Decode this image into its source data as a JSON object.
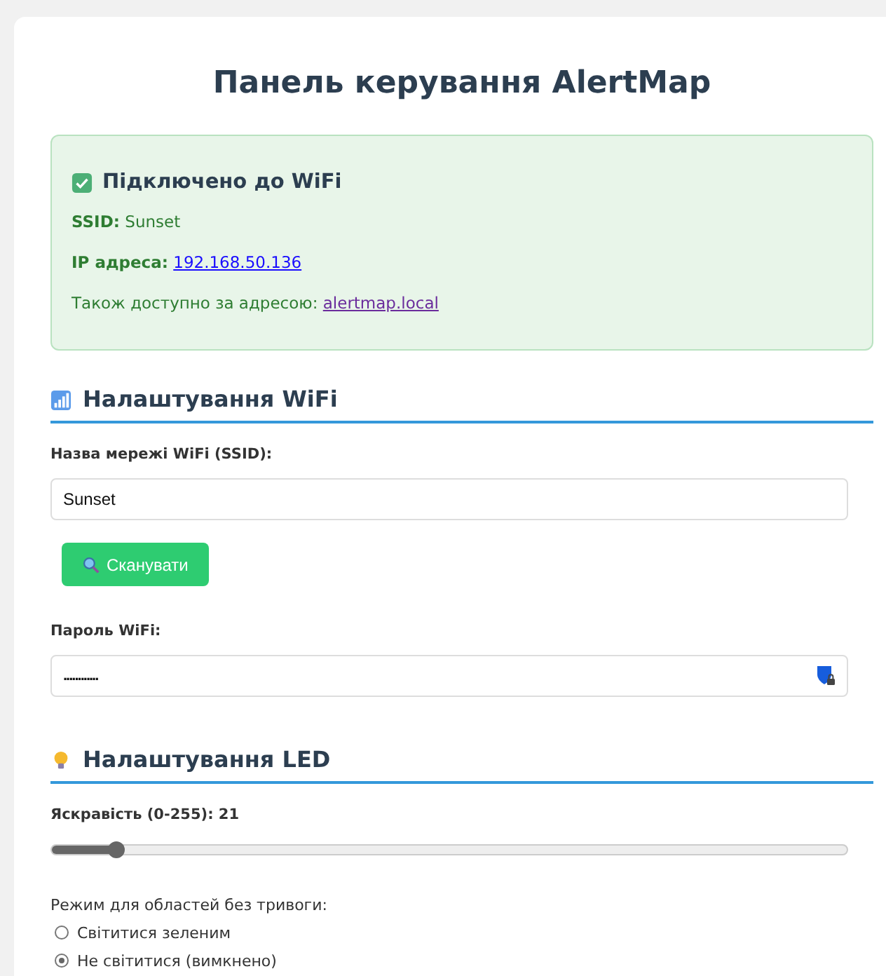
{
  "title": "Панель керування AlertMap",
  "status": {
    "connected": true,
    "heading": "Підключено до WiFi",
    "ssid_label": "SSID:",
    "ssid": "Sunset",
    "ip_label": "IP адреса:",
    "ip": "192.168.50.136",
    "alt_text": "Також доступно за адресою:",
    "alt_link": "alertmap.local"
  },
  "wifi": {
    "heading": "Налаштування WiFi",
    "ssid_label": "Назва мережі WiFi (SSID):",
    "ssid_value": "Sunset",
    "scan_button": "Сканувати",
    "password_label": "Пароль WiFi:",
    "password_value": "............"
  },
  "led": {
    "heading": "Налаштування LED",
    "brightness_label": "Яскравість (0-255): 21",
    "brightness": {
      "level": 0.082
    },
    "mode_label": "Режим для областей без тривоги:",
    "modes": [
      {
        "label": "Світитися зеленим",
        "selected": false
      },
      {
        "label": "Не світитися (вимкнено)",
        "selected": true
      }
    ]
  }
}
